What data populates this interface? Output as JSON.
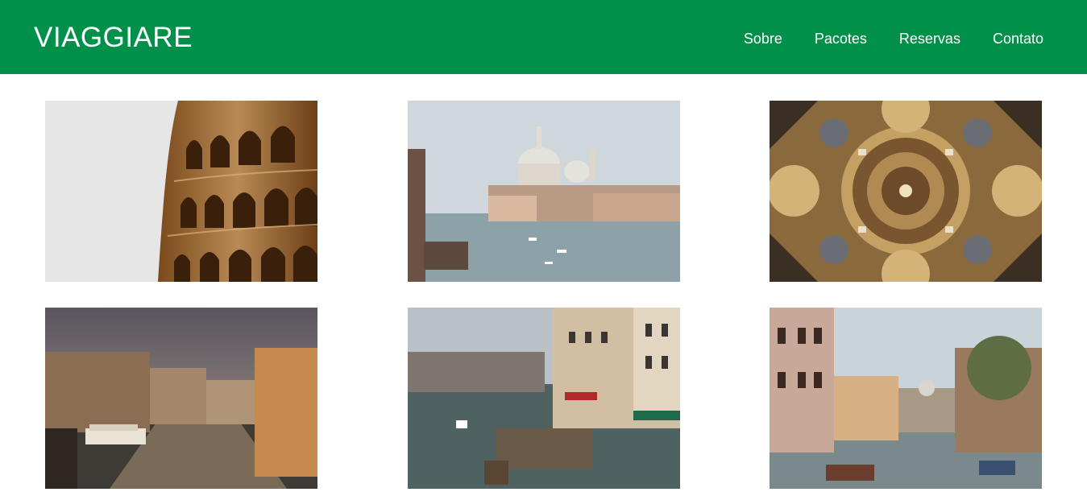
{
  "header": {
    "brand": "VIAGGIARE",
    "nav": [
      "Sobre",
      "Pacotes",
      "Reservas",
      "Contato"
    ],
    "background": "#00904a"
  },
  "gallery": {
    "images": [
      {
        "subject": "colosseum"
      },
      {
        "subject": "venice-grand-canal-basilica"
      },
      {
        "subject": "baroque-dome-ceiling"
      },
      {
        "subject": "venice-canal-sunset"
      },
      {
        "subject": "venice-canal-boats"
      },
      {
        "subject": "venice-narrow-canal"
      }
    ]
  }
}
